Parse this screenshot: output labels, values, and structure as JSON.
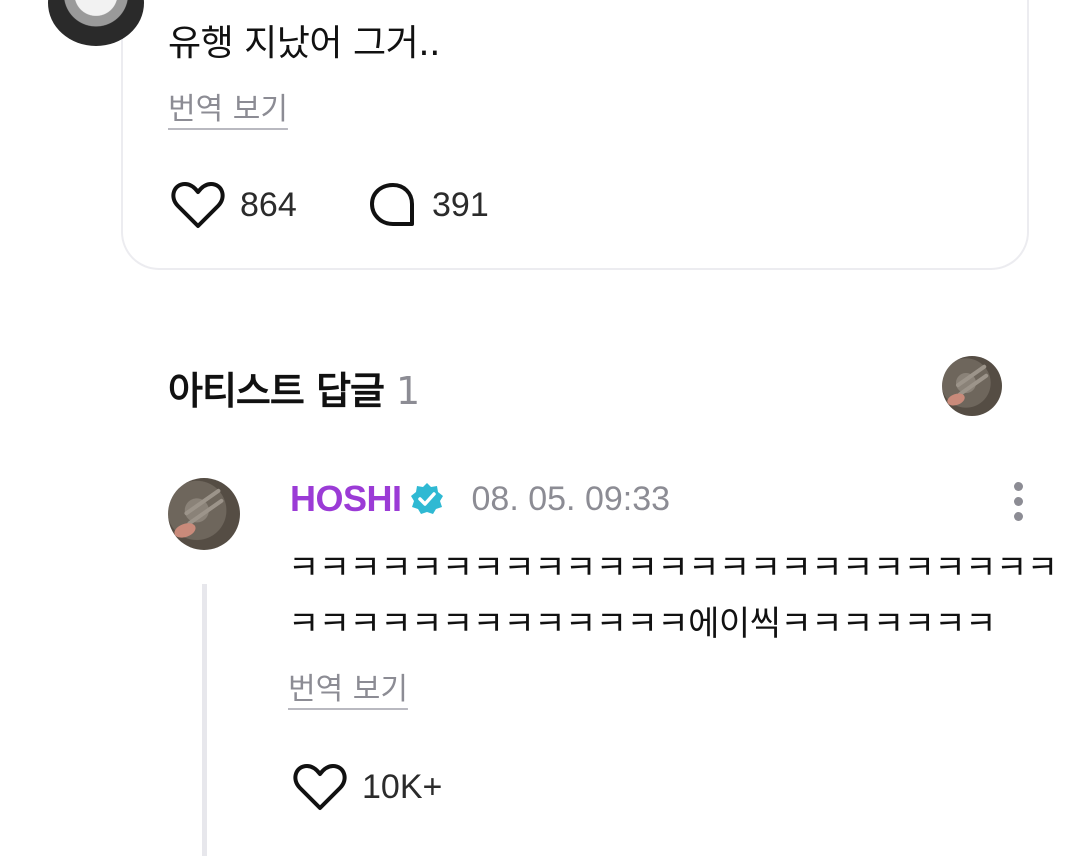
{
  "post": {
    "text": "유행 지났어 그거..",
    "translate_label": "번역 보기",
    "like_count": "864",
    "comment_count": "391"
  },
  "artist_replies": {
    "title": "아티스트 답글",
    "count": "1"
  },
  "reply": {
    "author": "HOSHI",
    "timestamp": "08. 05. 09:33",
    "line1": "ㅋㅋㅋㅋㅋㅋㅋㅋㅋㅋㅋㅋㅋㅋㅋㅋㅋㅋㅋㅋㅋㅋㅋㅋㅋ",
    "line2": "ㅋㅋㅋㅋㅋㅋㅋㅋㅋㅋㅋㅋㅋ에이씩ㅋㅋㅋㅋㅋㅋㅋ",
    "translate_label": "번역 보기",
    "like_count": "10K+"
  },
  "colors": {
    "author_name": "#9b3bd6",
    "verified_badge": "#2fb9d3",
    "muted_text": "#8c8c94",
    "card_border": "#ececf0"
  },
  "icons": [
    "heart-icon",
    "comment-bubble-icon",
    "verified-badge-icon",
    "more-vertical-icon"
  ]
}
